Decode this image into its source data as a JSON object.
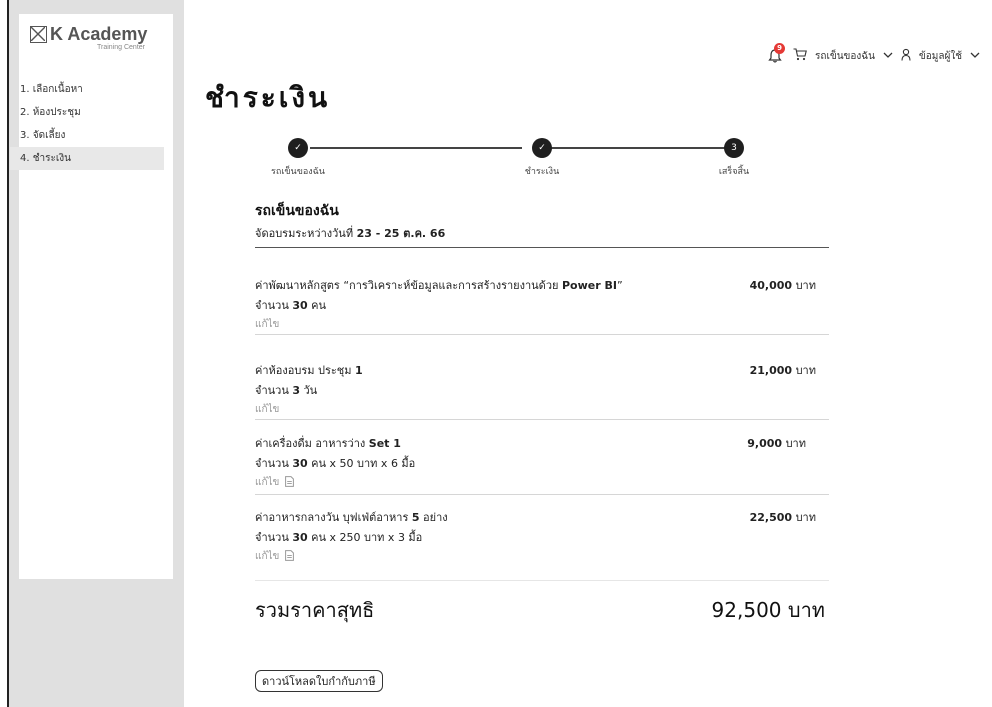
{
  "logo": {
    "name": "K Academy",
    "subtitle": "Training Center"
  },
  "sidebar": {
    "items": [
      {
        "label": "1. เลือกเนื้อหา"
      },
      {
        "label": "2. ห้องประชุม"
      },
      {
        "label": "3. จัดเลี้ยง"
      },
      {
        "label": "4. ชำระเงิน",
        "active": true
      }
    ]
  },
  "topbar": {
    "notification_count": "9",
    "cart_label": "รถเข็นของฉัน",
    "profile_label": "ข้อมูลผู้ใช้"
  },
  "page": {
    "title": "ชำระเงิน"
  },
  "stepper": {
    "steps": [
      {
        "label": "รถเข็นของฉัน",
        "state": "done",
        "mark": "✓"
      },
      {
        "label": "ชำระเงิน",
        "state": "done",
        "mark": "✓"
      },
      {
        "label": "เสร็จสิ้น",
        "state": "current",
        "mark": "3"
      }
    ]
  },
  "cart": {
    "title": "รถเข็นของฉัน",
    "subtitle_prefix": "จัดอบรมระหว่างวันที่ ",
    "subtitle_dates": "23 - 25 ต.ค.  66",
    "items": [
      {
        "name_prefix": "ค่าพัฒนาหลักสูตร “การวิเคราะห์ข้อมูลและการสร้างรายงานด้วย ",
        "name_bold": "Power BI",
        "name_suffix": "”",
        "qty_prefix": "จำนวน ",
        "qty_bold": "30",
        "qty_suffix": " คน",
        "price_bold": "40,000",
        "price_unit": " บาท",
        "edit_label": "แก้ไข",
        "has_doc_icon": false
      },
      {
        "name_prefix": "ค่าห้องอบรม ประชุม ",
        "name_bold": "1",
        "name_suffix": "",
        "qty_prefix": "จำนวน ",
        "qty_bold": "3",
        "qty_suffix": " วัน",
        "price_bold": "21,000",
        "price_unit": " บาท",
        "edit_label": "แก้ไข",
        "has_doc_icon": false
      },
      {
        "name_prefix": "ค่าเครื่องดื่ม อาหารว่าง  ",
        "name_bold": "Set 1",
        "name_suffix": "",
        "qty_prefix": "จำนวน ",
        "qty_bold": "30",
        "qty_suffix": " คน x 50 บาท x 6 มื้อ",
        "price_bold": "9,000",
        "price_unit": " บาท",
        "edit_label": "แก้ไข",
        "has_doc_icon": true
      },
      {
        "name_prefix": "ค่าอาหารกลางวัน บุฟเฟ่ต์อาหาร ",
        "name_bold": "5",
        "name_suffix": " อย่าง",
        "qty_prefix": "จำนวน ",
        "qty_bold": "30",
        "qty_suffix": " คน x 250 บาท x 3 มื้อ",
        "price_bold": "22,500",
        "price_unit": " บาท",
        "edit_label": "แก้ไข",
        "has_doc_icon": true
      }
    ]
  },
  "total": {
    "label": "รวมราคาสุทธิ",
    "amount": "92,500 บาท"
  },
  "download_button": "ดาวน์โหลดใบกำกับภาษี"
}
